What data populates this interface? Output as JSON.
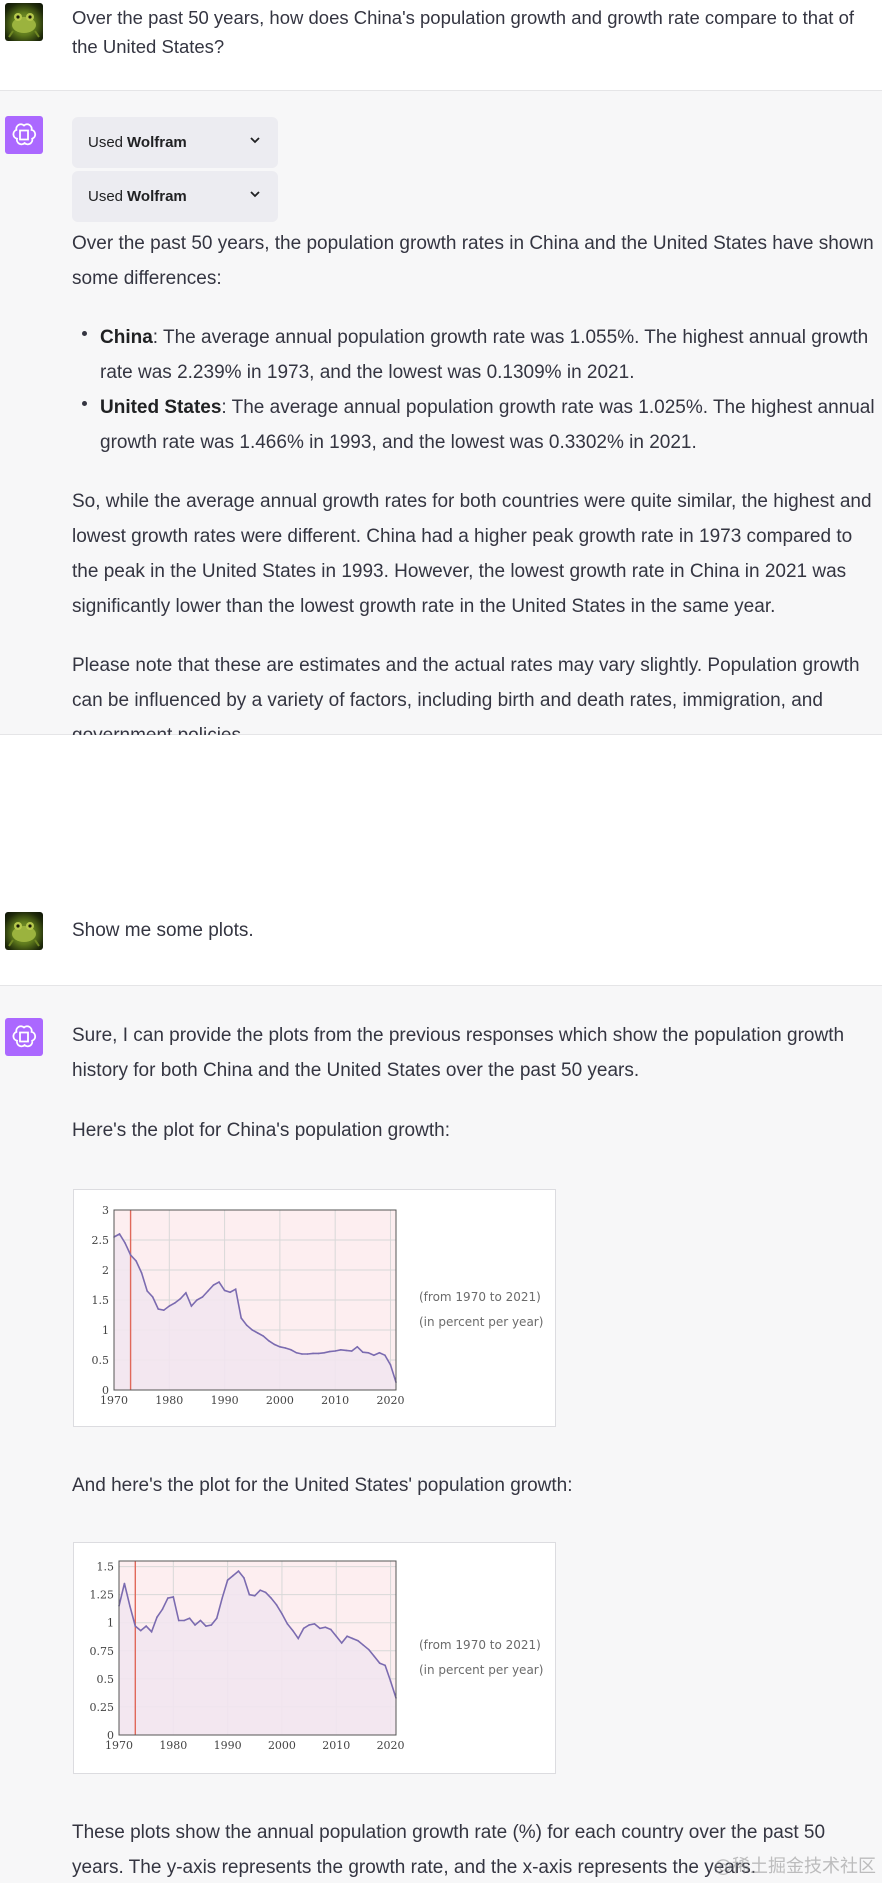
{
  "messages": {
    "q1": "Over the past 50 years, how does China's population growth and growth rate compare to that of the United States?",
    "plugin": {
      "used_label": "Used",
      "plugin_name": "Wolfram"
    },
    "a1": {
      "intro": "Over the past 50 years, the population growth rates in China and the United States have shown some differences:",
      "bullets": [
        {
          "country": "China",
          "text": ": The average annual population growth rate was 1.055%. The highest annual growth rate was 2.239% in 1973, and the lowest was 0.1309% in 2021."
        },
        {
          "country": "United States",
          "text": ": The average annual population growth rate was 1.025%. The highest annual growth rate was 1.466% in 1993, and the lowest was 0.3302% in 2021."
        }
      ],
      "para2": "So, while the average annual growth rates for both countries were quite similar, the highest and lowest growth rates were different. China had a higher peak growth rate in 1973 compared to the peak in the United States in 1993. However, the lowest growth rate in China in 2021 was significantly lower than the lowest growth rate in the United States in the same year.",
      "para3": "Please note that these are estimates and the actual rates may vary slightly. Population growth can be influenced by a variety of factors, including birth and death rates, immigration, and government policies."
    },
    "q2": "Show me some plots.",
    "a2": {
      "intro": "Sure, I can provide the plots from the previous responses which show the population growth history for both China and the United States over the past 50 years.",
      "china_caption": "Here's the plot for China's population growth:",
      "us_caption": "And here's the plot for the United States' population growth:",
      "closing": "These plots show the annual population growth rate (%) for each country over the past 50 years. The y-axis represents the growth rate, and the x-axis represents the years."
    }
  },
  "watermark": "@稀土掘金技术社区",
  "chart_data": [
    {
      "type": "area",
      "title": "",
      "notes": [
        "(from 1970 to 2021)",
        "(in percent per year)"
      ],
      "xlim": [
        1970,
        2021
      ],
      "ylim": [
        0,
        3
      ],
      "xticks": [
        1970,
        1980,
        1990,
        2000,
        2010,
        2020
      ],
      "yticks": [
        0,
        0.5,
        1,
        1.5,
        2,
        2.5,
        3
      ],
      "ytick_labels": [
        "0",
        "0.5",
        "1",
        "1.5",
        "2",
        "2.5",
        "3"
      ],
      "marker_year": 1973,
      "line_color": "#7b6bb0",
      "fill_color": "#f2e6ef",
      "plot_bg": "#fdeef0",
      "x": [
        1970,
        1971,
        1972,
        1973,
        1974,
        1975,
        1976,
        1977,
        1978,
        1979,
        1980,
        1981,
        1982,
        1983,
        1984,
        1985,
        1986,
        1987,
        1988,
        1989,
        1990,
        1991,
        1992,
        1993,
        1994,
        1995,
        1996,
        1997,
        1998,
        1999,
        2000,
        2001,
        2002,
        2003,
        2004,
        2005,
        2006,
        2007,
        2008,
        2009,
        2010,
        2011,
        2012,
        2013,
        2014,
        2015,
        2016,
        2017,
        2018,
        2019,
        2020,
        2021
      ],
      "y": [
        2.55,
        2.6,
        2.45,
        2.25,
        2.15,
        1.95,
        1.65,
        1.55,
        1.35,
        1.33,
        1.4,
        1.45,
        1.52,
        1.62,
        1.4,
        1.5,
        1.55,
        1.65,
        1.75,
        1.8,
        1.66,
        1.63,
        1.68,
        1.2,
        1.08,
        1.0,
        0.95,
        0.9,
        0.82,
        0.76,
        0.72,
        0.7,
        0.67,
        0.62,
        0.6,
        0.6,
        0.61,
        0.61,
        0.62,
        0.64,
        0.65,
        0.67,
        0.66,
        0.65,
        0.72,
        0.63,
        0.62,
        0.58,
        0.62,
        0.58,
        0.42,
        0.13
      ]
    },
    {
      "type": "area",
      "title": "",
      "notes": [
        "(from 1970 to 2021)",
        "(in percent per year)"
      ],
      "xlim": [
        1970,
        2021
      ],
      "ylim": [
        0,
        1.55
      ],
      "xticks": [
        1970,
        1980,
        1990,
        2000,
        2010,
        2020
      ],
      "yticks": [
        0,
        0.25,
        0.5,
        0.75,
        1,
        1.25,
        1.5
      ],
      "ytick_labels": [
        "0",
        "0.25",
        "0.5",
        "0.75",
        "1",
        "1.25",
        "1.5"
      ],
      "marker_year": 1973,
      "line_color": "#7b6bb0",
      "fill_color": "#f2e6ef",
      "plot_bg": "#fdeef0",
      "x": [
        1970,
        1971,
        1972,
        1973,
        1974,
        1975,
        1976,
        1977,
        1978,
        1979,
        1980,
        1981,
        1982,
        1983,
        1984,
        1985,
        1986,
        1987,
        1988,
        1989,
        1990,
        1991,
        1992,
        1993,
        1994,
        1995,
        1996,
        1997,
        1998,
        1999,
        2000,
        2001,
        2002,
        2003,
        2004,
        2005,
        2006,
        2007,
        2008,
        2009,
        2010,
        2011,
        2012,
        2013,
        2014,
        2015,
        2016,
        2017,
        2018,
        2019,
        2020,
        2021
      ],
      "y": [
        1.15,
        1.35,
        1.15,
        0.97,
        0.93,
        0.97,
        0.92,
        1.05,
        1.12,
        1.22,
        1.23,
        1.02,
        1.02,
        1.04,
        0.98,
        1.02,
        0.97,
        0.98,
        1.04,
        1.22,
        1.38,
        1.42,
        1.46,
        1.4,
        1.25,
        1.24,
        1.29,
        1.27,
        1.22,
        1.16,
        1.08,
        0.99,
        0.93,
        0.86,
        0.95,
        0.98,
        0.99,
        0.95,
        0.96,
        0.94,
        0.88,
        0.82,
        0.88,
        0.86,
        0.84,
        0.8,
        0.76,
        0.7,
        0.64,
        0.62,
        0.48,
        0.33
      ]
    }
  ]
}
